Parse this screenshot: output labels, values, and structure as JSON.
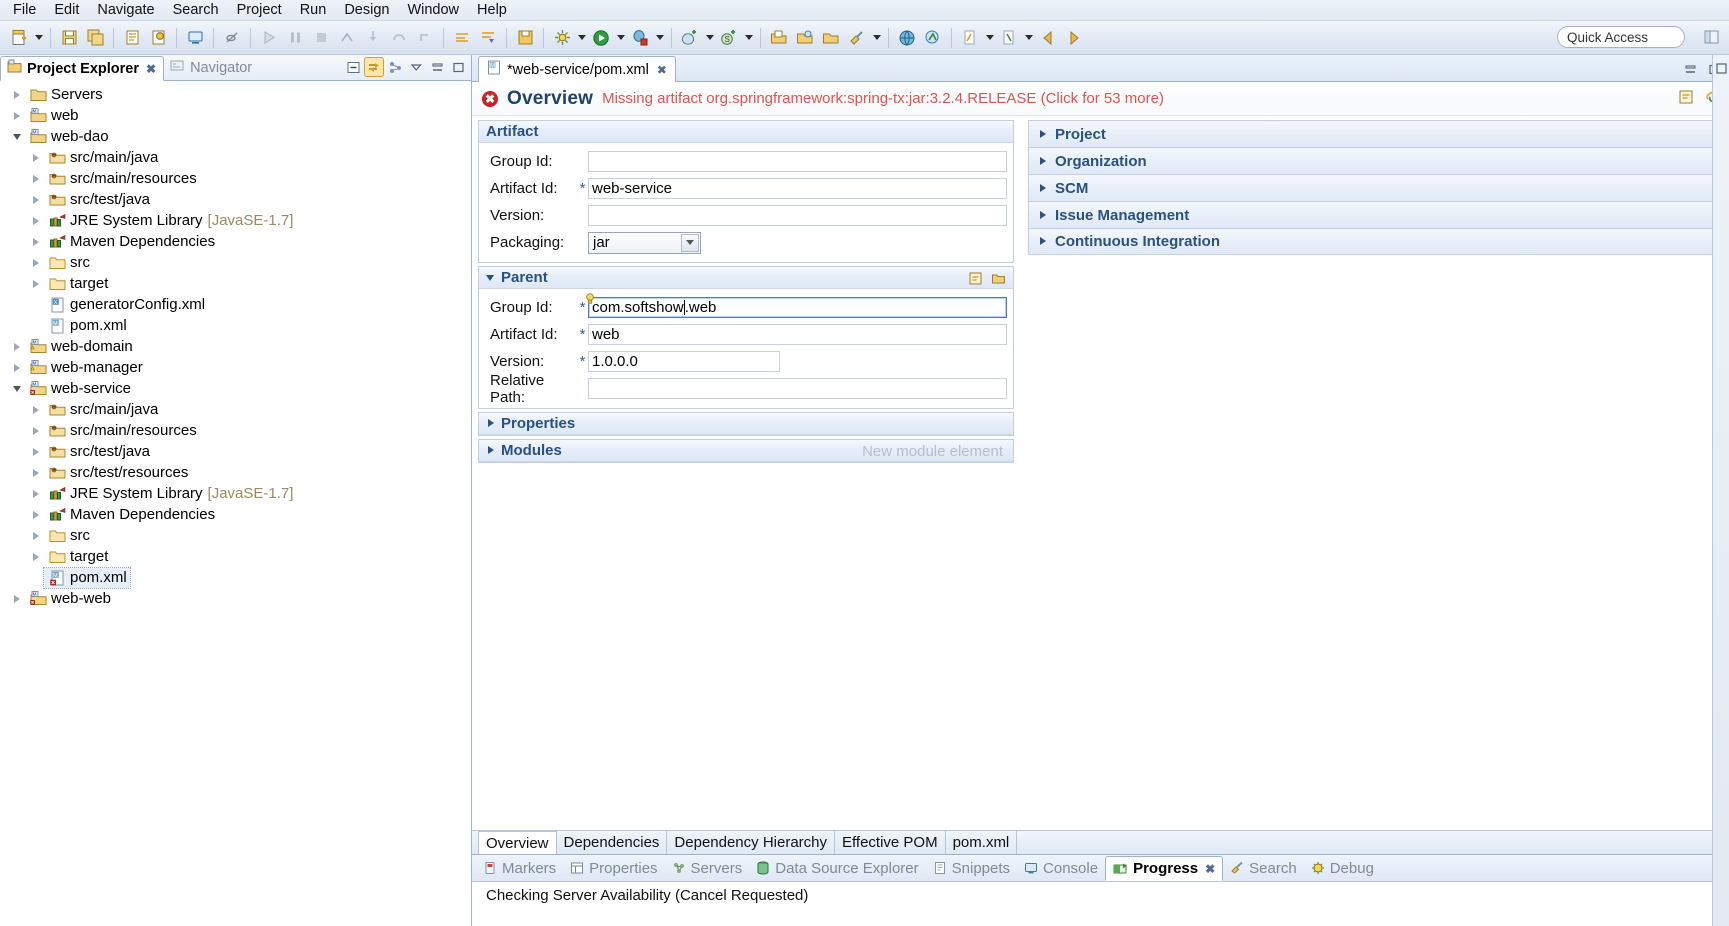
{
  "menubar": {
    "items": [
      {
        "label": "File"
      },
      {
        "label": "Edit"
      },
      {
        "label": "Navigate"
      },
      {
        "label": "Search"
      },
      {
        "label": "Project"
      },
      {
        "label": "Run"
      },
      {
        "label": "Design"
      },
      {
        "label": "Window"
      },
      {
        "label": "Help"
      }
    ]
  },
  "toolbar": {
    "quick_access_placeholder": "Quick Access",
    "icons": [
      "new-wizard-icon",
      "save-icon",
      "save-all-icon",
      "print-icon",
      "validate-icon",
      "open-console-icon",
      "toggle-breakpoint-icon",
      "resume-icon",
      "suspend-icon",
      "terminate-icon",
      "step-into-icon",
      "step-over-icon",
      "step-return-icon",
      "last-edit-location-icon",
      "next-annotation-icon",
      "save-session-icon",
      "external-tools-icon",
      "run-icon",
      "debug-icon",
      "new-server-icon",
      "new-spring-element-icon",
      "open-type-icon",
      "open-task-icon",
      "search-icon",
      "pin-editor-icon",
      "open-web-browser-icon",
      "profile-icon",
      "previous-edit-icon",
      "back-icon",
      "forward-icon"
    ]
  },
  "left_pane": {
    "tabs": [
      {
        "label": "Project Explorer",
        "icon": "project-explorer-icon",
        "active": true,
        "closable": true
      },
      {
        "label": "Navigator",
        "icon": "navigator-icon",
        "active": false,
        "closable": false
      }
    ],
    "toolbar_icons": [
      "collapse-all-icon",
      "link-with-editor-icon",
      "view-menu-hierarchy-icon",
      "view-menu-icon",
      "minimize-icon",
      "maximize-icon"
    ],
    "tree": [
      {
        "label": "Servers",
        "indent": 0,
        "twisty": "collapsed",
        "icon": "folder-servers-icon",
        "suffix": "",
        "selected": false
      },
      {
        "label": "web",
        "indent": 0,
        "twisty": "collapsed",
        "icon": "maven-project-icon",
        "suffix": "",
        "selected": false
      },
      {
        "label": "web-dao",
        "indent": 0,
        "twisty": "expanded",
        "icon": "maven-project-icon",
        "suffix": "",
        "selected": false
      },
      {
        "label": "src/main/java",
        "indent": 1,
        "twisty": "collapsed",
        "icon": "source-folder-icon",
        "suffix": "",
        "selected": false
      },
      {
        "label": "src/main/resources",
        "indent": 1,
        "twisty": "collapsed",
        "icon": "source-folder-icon",
        "suffix": "",
        "selected": false
      },
      {
        "label": "src/test/java",
        "indent": 1,
        "twisty": "collapsed",
        "icon": "source-folder-icon",
        "suffix": "",
        "selected": false
      },
      {
        "label": "JRE System Library",
        "indent": 1,
        "twisty": "collapsed",
        "icon": "library-icon",
        "suffix": "[JavaSE-1.7]",
        "selected": false
      },
      {
        "label": "Maven Dependencies",
        "indent": 1,
        "twisty": "collapsed",
        "icon": "library-icon",
        "suffix": "",
        "selected": false
      },
      {
        "label": "src",
        "indent": 1,
        "twisty": "collapsed",
        "icon": "folder-icon",
        "suffix": "",
        "selected": false
      },
      {
        "label": "target",
        "indent": 1,
        "twisty": "collapsed",
        "icon": "folder-icon",
        "suffix": "",
        "selected": false
      },
      {
        "label": "generatorConfig.xml",
        "indent": 1,
        "twisty": "none",
        "icon": "xml-file-icon",
        "suffix": "",
        "selected": false
      },
      {
        "label": "pom.xml",
        "indent": 1,
        "twisty": "none",
        "icon": "maven-pom-icon",
        "suffix": "",
        "selected": false
      },
      {
        "label": "web-domain",
        "indent": 0,
        "twisty": "collapsed",
        "icon": "maven-project-warn-icon",
        "suffix": "",
        "selected": false
      },
      {
        "label": "web-manager",
        "indent": 0,
        "twisty": "collapsed",
        "icon": "maven-project-warn-icon",
        "suffix": "",
        "selected": false
      },
      {
        "label": "web-service",
        "indent": 0,
        "twisty": "expanded",
        "icon": "maven-project-error-icon",
        "suffix": "",
        "selected": false
      },
      {
        "label": "src/main/java",
        "indent": 1,
        "twisty": "collapsed",
        "icon": "source-folder-icon",
        "suffix": "",
        "selected": false
      },
      {
        "label": "src/main/resources",
        "indent": 1,
        "twisty": "collapsed",
        "icon": "source-folder-icon",
        "suffix": "",
        "selected": false
      },
      {
        "label": "src/test/java",
        "indent": 1,
        "twisty": "collapsed",
        "icon": "source-folder-icon",
        "suffix": "",
        "selected": false
      },
      {
        "label": "src/test/resources",
        "indent": 1,
        "twisty": "collapsed",
        "icon": "source-folder-icon",
        "suffix": "",
        "selected": false
      },
      {
        "label": "JRE System Library",
        "indent": 1,
        "twisty": "collapsed",
        "icon": "library-icon",
        "suffix": "[JavaSE-1.7]",
        "selected": false
      },
      {
        "label": "Maven Dependencies",
        "indent": 1,
        "twisty": "collapsed",
        "icon": "library-icon",
        "suffix": "",
        "selected": false
      },
      {
        "label": "src",
        "indent": 1,
        "twisty": "collapsed",
        "icon": "folder-icon",
        "suffix": "",
        "selected": false
      },
      {
        "label": "target",
        "indent": 1,
        "twisty": "collapsed",
        "icon": "folder-icon",
        "suffix": "",
        "selected": false
      },
      {
        "label": "pom.xml",
        "indent": 1,
        "twisty": "none",
        "icon": "maven-pom-error-icon",
        "suffix": "",
        "selected": true
      },
      {
        "label": "web-web",
        "indent": 0,
        "twisty": "collapsed",
        "icon": "maven-project-error-icon",
        "suffix": "",
        "selected": false
      }
    ]
  },
  "editor": {
    "tab": {
      "title": "*web-service/pom.xml",
      "icon": "maven-pom-icon",
      "close": "✕"
    },
    "header": {
      "status_icon": "error-icon",
      "title": "Overview",
      "error_message": "Missing artifact org.springframework:spring-tx:jar:3.2.4.RELEASE (Click for 53 more)",
      "actions": [
        "form-help-icon",
        "link-icon"
      ]
    },
    "artifact_section": {
      "title": "Artifact",
      "fields": [
        {
          "label": "Group Id:",
          "required": false,
          "value": "",
          "type": "text"
        },
        {
          "label": "Artifact Id:",
          "required": true,
          "value": "web-service",
          "type": "text"
        },
        {
          "label": "Version:",
          "required": false,
          "value": "",
          "type": "text"
        },
        {
          "label": "Packaging:",
          "required": false,
          "value": "jar",
          "type": "combo"
        }
      ]
    },
    "parent_section": {
      "title": "Parent",
      "expanded": true,
      "actions": [
        "select-parent-icon",
        "open-parent-pom-icon"
      ],
      "fields": [
        {
          "label": "Group Id:",
          "required": true,
          "value": "com.softshow.web",
          "type": "text",
          "focused": true,
          "caret_after": "com.softshow"
        },
        {
          "label": "Artifact Id:",
          "required": true,
          "value": "web",
          "type": "text",
          "focused": false
        },
        {
          "label": "Version:",
          "required": true,
          "value": "1.0.0.0",
          "type": "text",
          "focused": false,
          "short": true
        },
        {
          "label": "Relative Path:",
          "required": false,
          "value": "",
          "type": "text",
          "focused": false
        }
      ]
    },
    "properties_section": {
      "title": "Properties",
      "expanded": false
    },
    "modules_section": {
      "title": "Modules",
      "expanded": false,
      "hint": "New module element"
    },
    "right_sections": [
      {
        "title": "Project"
      },
      {
        "title": "Organization"
      },
      {
        "title": "SCM"
      },
      {
        "title": "Issue Management"
      },
      {
        "title": "Continuous Integration"
      }
    ],
    "page_tabs": [
      {
        "label": "Overview",
        "active": true
      },
      {
        "label": "Dependencies",
        "active": false
      },
      {
        "label": "Dependency Hierarchy",
        "active": false
      },
      {
        "label": "Effective POM",
        "active": false
      },
      {
        "label": "pom.xml",
        "active": false
      }
    ]
  },
  "bottom_views": {
    "tabs": [
      {
        "label": "Markers",
        "icon": "markers-icon",
        "active": false,
        "closable": false
      },
      {
        "label": "Properties",
        "icon": "properties-icon",
        "active": false,
        "closable": false
      },
      {
        "label": "Servers",
        "icon": "servers-icon",
        "active": false,
        "closable": false
      },
      {
        "label": "Data Source Explorer",
        "icon": "data-source-explorer-icon",
        "active": false,
        "closable": false
      },
      {
        "label": "Snippets",
        "icon": "snippets-icon",
        "active": false,
        "closable": false
      },
      {
        "label": "Console",
        "icon": "console-icon",
        "active": false,
        "closable": false
      },
      {
        "label": "Progress",
        "icon": "progress-icon",
        "active": true,
        "closable": true
      },
      {
        "label": "Search",
        "icon": "search-view-icon",
        "active": false,
        "closable": false
      },
      {
        "label": "Debug",
        "icon": "debug-view-icon",
        "active": false,
        "closable": false
      }
    ],
    "content": "Checking Server Availability (Cancel Requested)"
  },
  "colors": {
    "accent_blue": "#29527e",
    "error_red": "#e0534f",
    "tree_suffix": "#9c8a62",
    "tab_inactive": "#7d8b9c"
  }
}
